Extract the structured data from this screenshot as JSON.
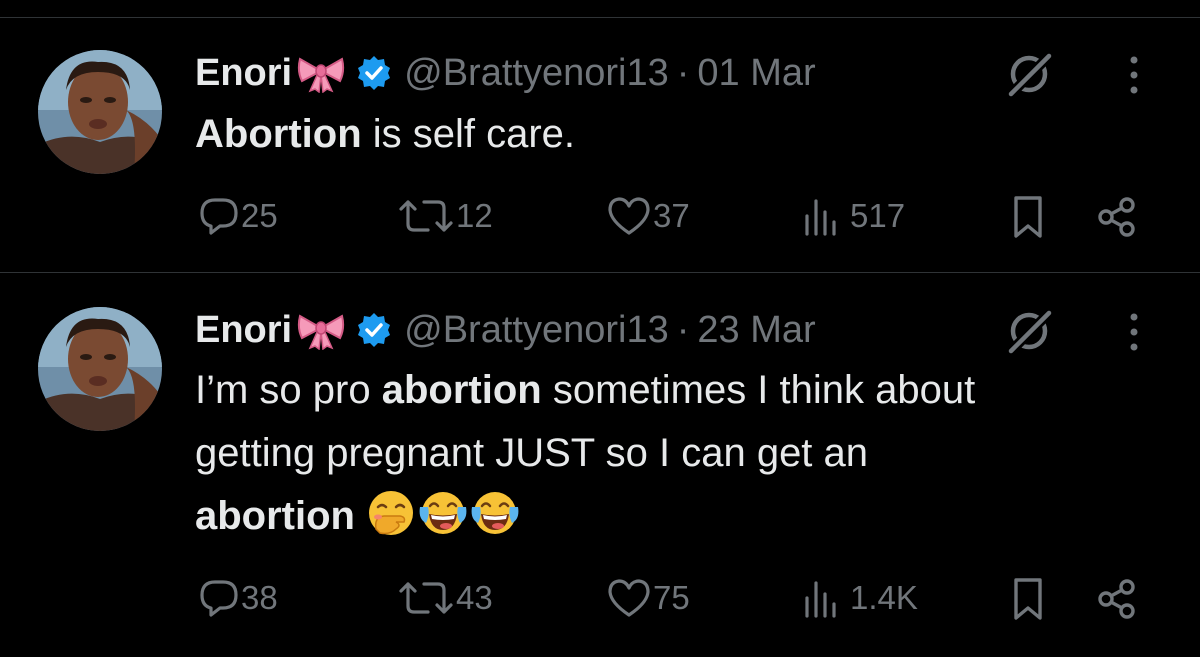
{
  "tweets": [
    {
      "author": {
        "name": "Enori",
        "handle": "@Brattyenori13"
      },
      "separator": "·",
      "date": "01 Mar",
      "text_segments": [
        {
          "text": "Abortion",
          "bold": true
        },
        {
          "text": " is self care.",
          "bold": false
        }
      ],
      "emojis": [],
      "stats": {
        "replies": "25",
        "reposts": "12",
        "likes": "37",
        "views": "517"
      }
    },
    {
      "author": {
        "name": "Enori",
        "handle": "@Brattyenori13"
      },
      "separator": "·",
      "date": "23 Mar",
      "text_lines": [
        [
          {
            "text": "I’m so pro ",
            "bold": false
          },
          {
            "text": "abortion",
            "bold": true
          },
          {
            "text": " sometimes I think about",
            "bold": false
          }
        ],
        [
          {
            "text": "getting pregnant JUST so I can get an",
            "bold": false
          }
        ],
        [
          {
            "text": "abortion",
            "bold": true
          },
          {
            "text": " ",
            "bold": false
          }
        ]
      ],
      "emojis": [
        "hand-over-mouth-emoji",
        "tears-of-joy-emoji",
        "tears-of-joy-emoji"
      ],
      "stats": {
        "replies": "38",
        "reposts": "43",
        "likes": "75",
        "views": "1.4K"
      }
    }
  ],
  "icons": {
    "verified": "verified-badge-icon",
    "bow": "ribbon-emoji",
    "grok": "grok-icon",
    "more": "more-dots-icon",
    "reply": "reply-icon",
    "repost": "repost-icon",
    "like": "like-icon",
    "views": "views-icon",
    "bookmark": "bookmark-icon",
    "share": "share-icon"
  },
  "colors": {
    "background": "#000000",
    "text": "#e7e9ea",
    "muted": "#71767b",
    "verified": "#1d9bf0",
    "divider": "#2f3336"
  }
}
